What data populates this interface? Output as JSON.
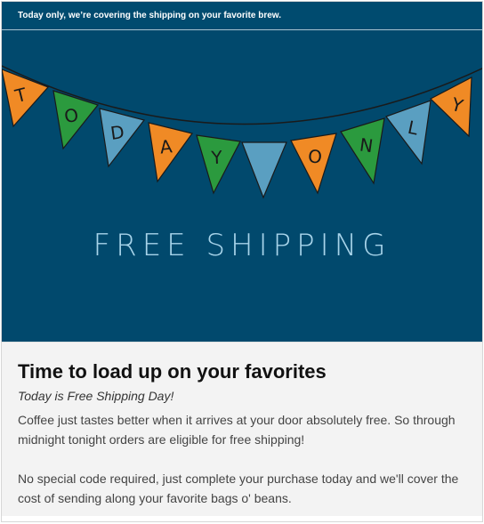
{
  "preheader": {
    "text": "Today only, we’re covering the shipping on your favorite brew."
  },
  "hero": {
    "background": "#01496d",
    "banner_letters": [
      "T",
      "O",
      "D",
      "A",
      "Y",
      "",
      "O",
      "N",
      "L",
      "Y"
    ],
    "flag_colors": [
      "#f08a25",
      "#2b9a3e",
      "#5a9fc1",
      "#f08a25",
      "#2b9a3e",
      "#5a9fc1",
      "#f08a25",
      "#2b9a3e",
      "#5a9fc1",
      "#f08a25"
    ],
    "title": "FREE SHIPPING"
  },
  "content": {
    "headline": "Time to load up on your favorites",
    "subhead": "Today is Free Shipping Day!",
    "paragraph_1": "Coffee just tastes better when it arrives at your door absolutely free. So through midnight tonight orders are eligible for free shipping!",
    "paragraph_2": "No special code required, just complete your purchase today and we'll cover the cost of sending along your favorite bags o' beans."
  }
}
